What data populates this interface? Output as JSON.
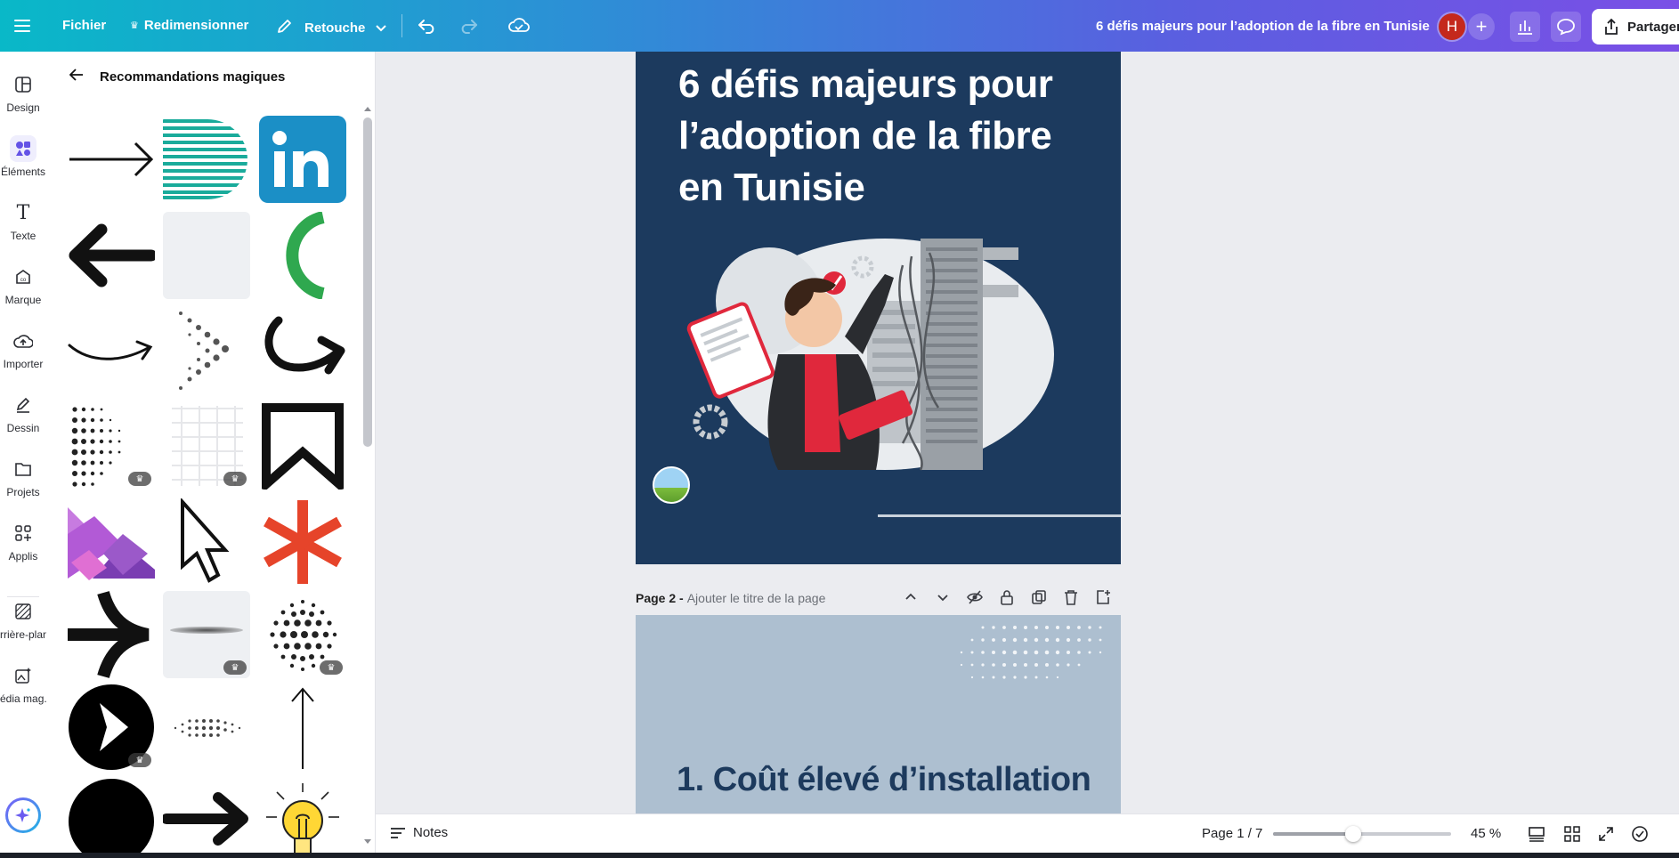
{
  "topbar": {
    "menu_icon": "hamburger-icon",
    "file_label": "Fichier",
    "resize_label": "Redimensionner",
    "retouch_label": "Retouche",
    "doc_title": "6 défis majeurs pour l’adoption de la fibre en Tunisie",
    "avatar_letter": "H",
    "share_label": "Partager"
  },
  "sidebar": {
    "items": [
      {
        "label": "Design",
        "icon": "layout-icon"
      },
      {
        "label": "Éléments",
        "icon": "shapes-icon"
      },
      {
        "label": "Texte",
        "icon": "text-icon"
      },
      {
        "label": "Marque",
        "icon": "brand-icon"
      },
      {
        "label": "Importer",
        "icon": "cloud-upload-icon"
      },
      {
        "label": "Dessin",
        "icon": "pen-icon"
      },
      {
        "label": "Projets",
        "icon": "folder-icon"
      },
      {
        "label": "Applis",
        "icon": "apps-icon"
      },
      {
        "label": "rrière-plan",
        "icon": "background-icon"
      },
      {
        "label": "édia mag...",
        "icon": "magic-media-icon"
      }
    ]
  },
  "panel": {
    "title": "Recommandations magiques",
    "premium_badge": "♛"
  },
  "page1": {
    "title_line1": "6 défis majeurs pour",
    "title_line2": "l’adoption de la fibre",
    "title_line3": "en Tunisie"
  },
  "page2": {
    "prefix": "Page 2 -",
    "title_placeholder": "Ajouter le titre de la page",
    "heading": "1. Coût élevé d’installation"
  },
  "bottombar": {
    "notes_label": "Notes",
    "page_indicator": "Page 1 / 7",
    "zoom_fraction": 0.45,
    "zoom_label": "45 %"
  },
  "colors": {
    "page1_bg": "#1c3a5e",
    "page2_bg": "#adbfd0",
    "accent_red": "#e0283c"
  }
}
